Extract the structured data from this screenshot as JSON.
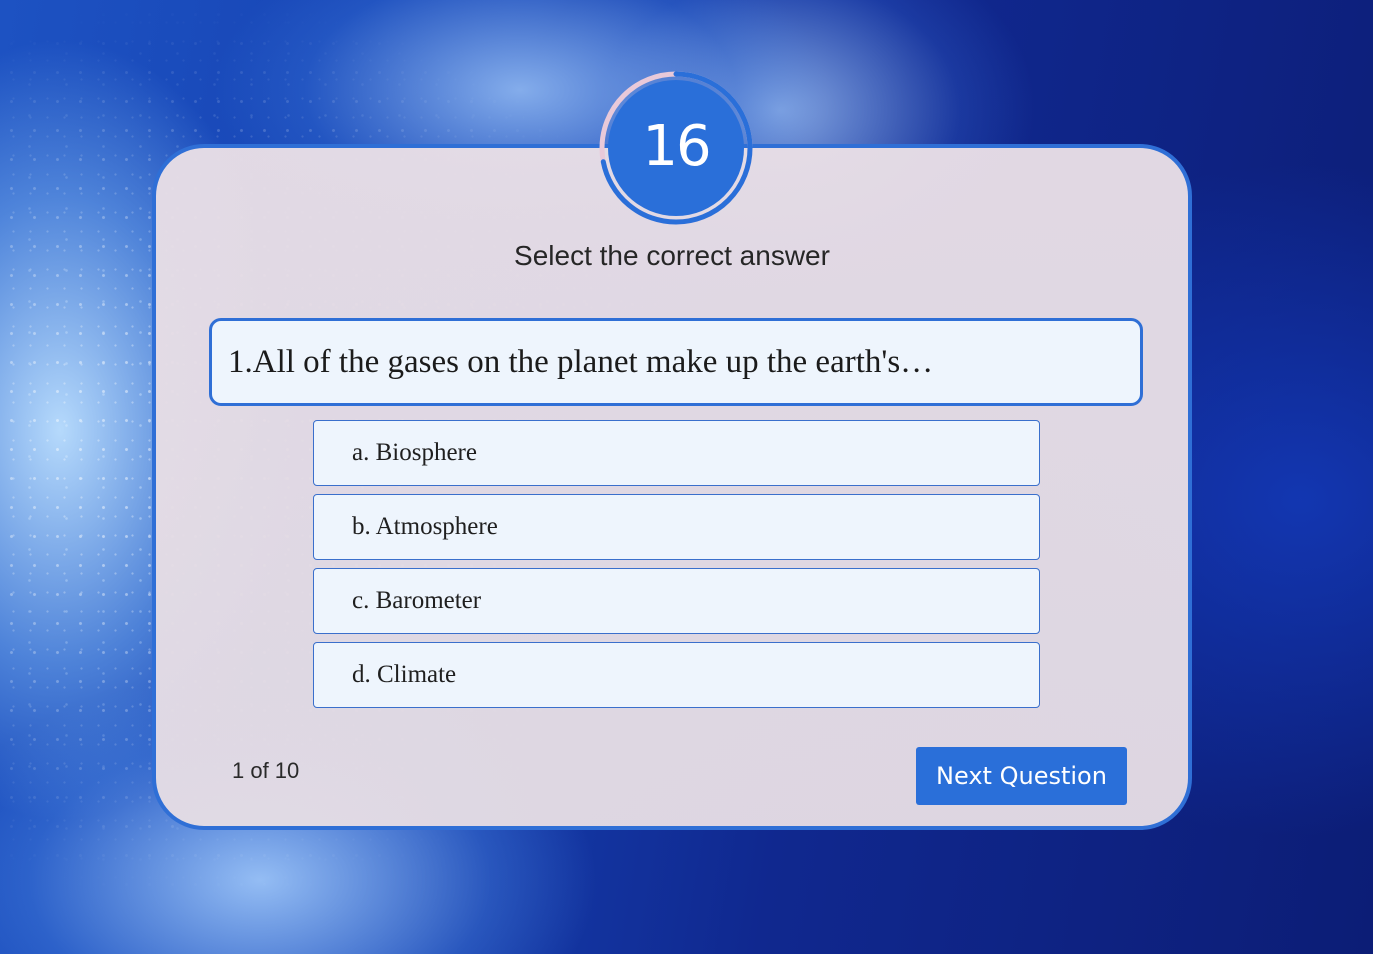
{
  "timer": {
    "value": "16",
    "remaining_fraction": 0.72,
    "fill_color": "#2a6fd9",
    "ring_color": "#e9c9d9"
  },
  "quiz": {
    "instruction": "Select the correct answer",
    "question": "1.All of the gases on the planet make up the earth's…",
    "options": [
      {
        "label": "a. Biosphere"
      },
      {
        "label": "b. Atmosphere"
      },
      {
        "label": "c. Barometer"
      },
      {
        "label": "d. Climate"
      }
    ],
    "progress": "1 of 10",
    "next_label": "Next Question"
  },
  "colors": {
    "accent": "#2f6fd6",
    "button": "#2a6fd9",
    "card_background": "#e6dde4",
    "option_background": "#eef5fd"
  }
}
